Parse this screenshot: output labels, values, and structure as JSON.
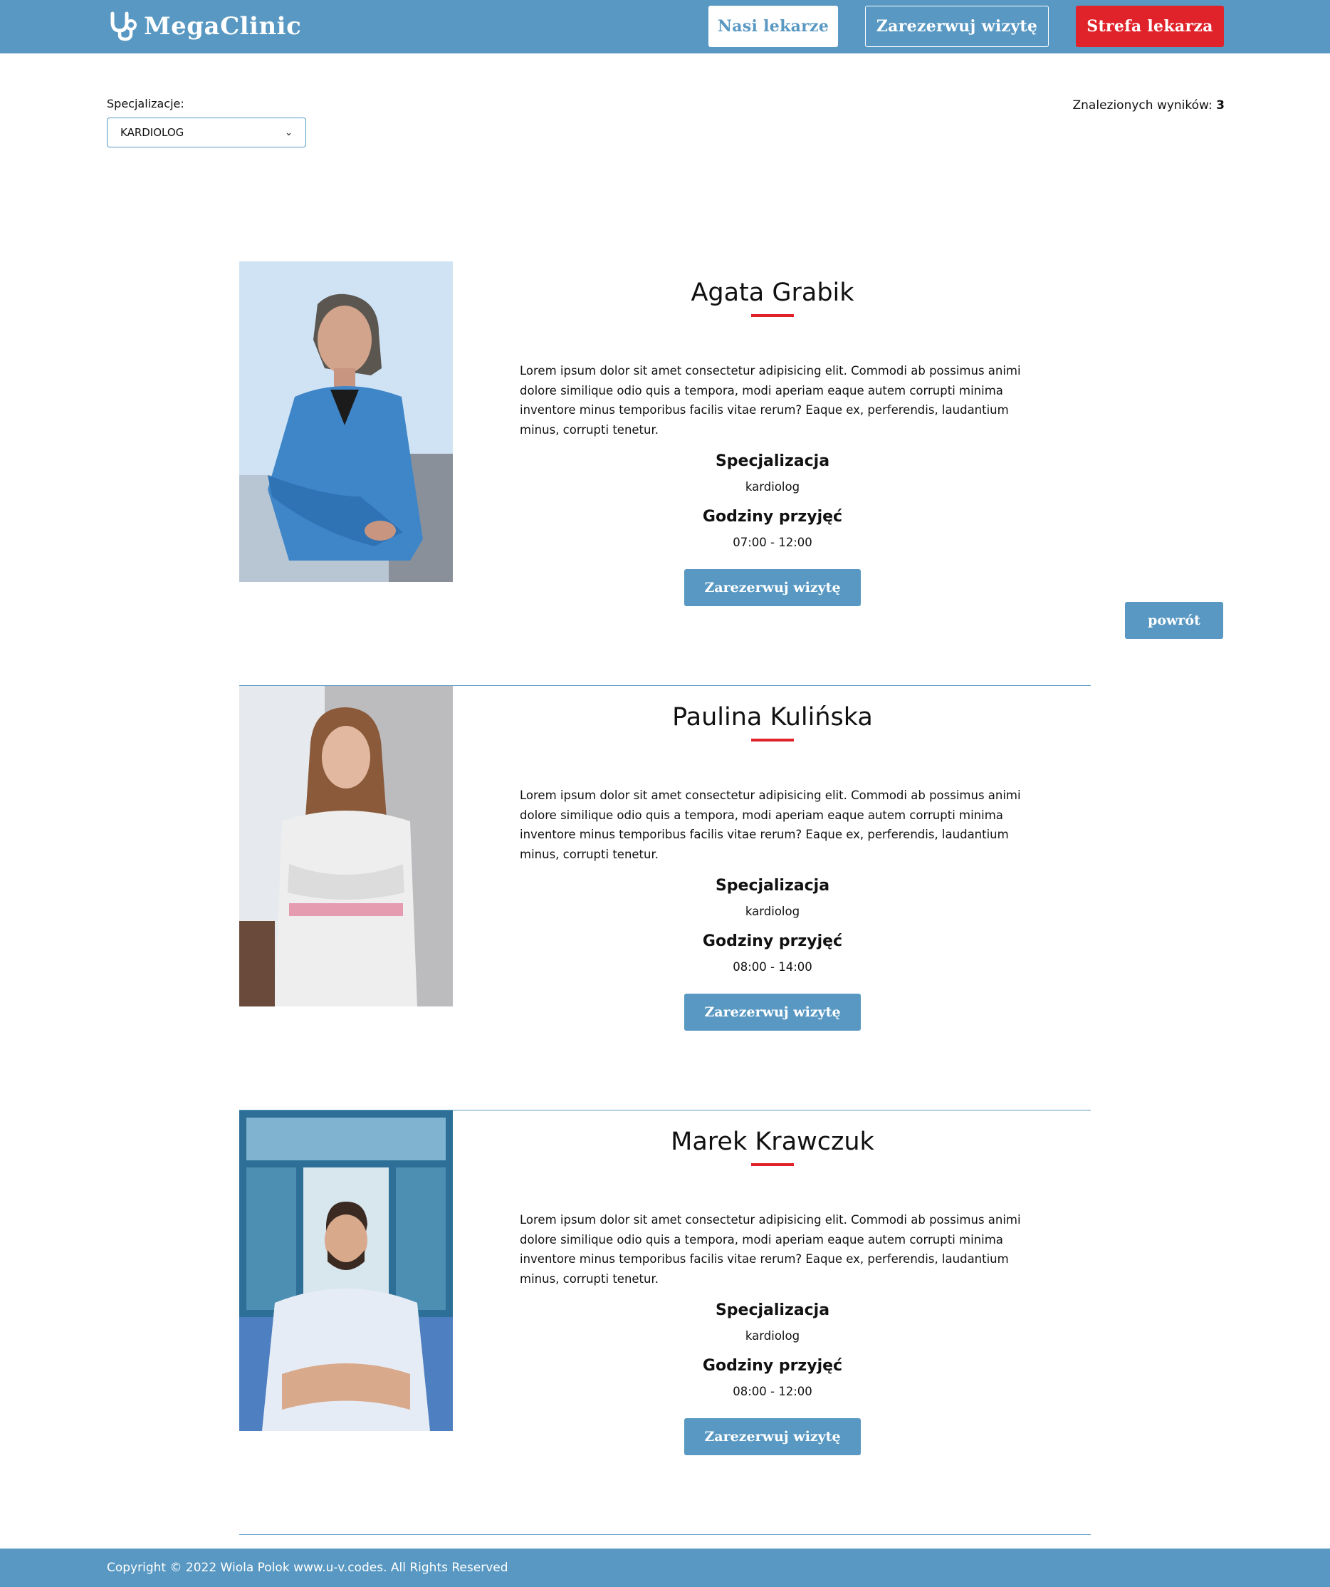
{
  "header": {
    "logo_text": "MegaClinic",
    "nav": {
      "doctors": "Nasi lekarze",
      "book": "Zarezerwuj wizytę",
      "doctor_zone": "Strefa lekarza"
    }
  },
  "filter": {
    "label": "Specjalizacje:",
    "selected": "KARDIOLOG",
    "results_label": "Znalezionych wyników:",
    "results_count": "3"
  },
  "doctors": [
    {
      "name": "Agata Grabik",
      "description": "Lorem ipsum dolor sit amet consectetur adipisicing elit. Commodi ab possimus animi dolore similique odio quis a tempora, modi aperiam eaque autem corrupti minima inventore minus temporibus facilis vitae rerum? Eaque ex, perferendis, laudantium minus, corrupti tenetur.",
      "specialization_title": "Specjalizacja",
      "specialization": "kardiolog",
      "hours_title": "Godziny przyjęć",
      "hours": "07:00 - 12:00",
      "book_label": "Zarezerwuj wizytę"
    },
    {
      "name": "Paulina Kulińska",
      "description": "Lorem ipsum dolor sit amet consectetur adipisicing elit. Commodi ab possimus animi dolore similique odio quis a tempora, modi aperiam eaque autem corrupti minima inventore minus temporibus facilis vitae rerum? Eaque ex, perferendis, laudantium minus, corrupti tenetur.",
      "specialization_title": "Specjalizacja",
      "specialization": "kardiolog",
      "hours_title": "Godziny przyjęć",
      "hours": "08:00 - 14:00",
      "book_label": "Zarezerwuj wizytę"
    },
    {
      "name": "Marek Krawczuk",
      "description": "Lorem ipsum dolor sit amet consectetur adipisicing elit. Commodi ab possimus animi dolore similique odio quis a tempora, modi aperiam eaque autem corrupti minima inventore minus temporibus facilis vitae rerum? Eaque ex, perferendis, laudantium minus, corrupti tenetur.",
      "specialization_title": "Specjalizacja",
      "specialization": "kardiolog",
      "hours_title": "Godziny przyjęć",
      "hours": "08:00 - 12:00",
      "book_label": "Zarezerwuj wizytę"
    }
  ],
  "back_label": "powrót",
  "footer": {
    "text": "Copyright © 2022 Wiola Polok www.u-v.codes. All Rights Reserved"
  },
  "colors": {
    "primary": "#5898c2",
    "accent": "#e0232a",
    "background": "#ffffff"
  }
}
